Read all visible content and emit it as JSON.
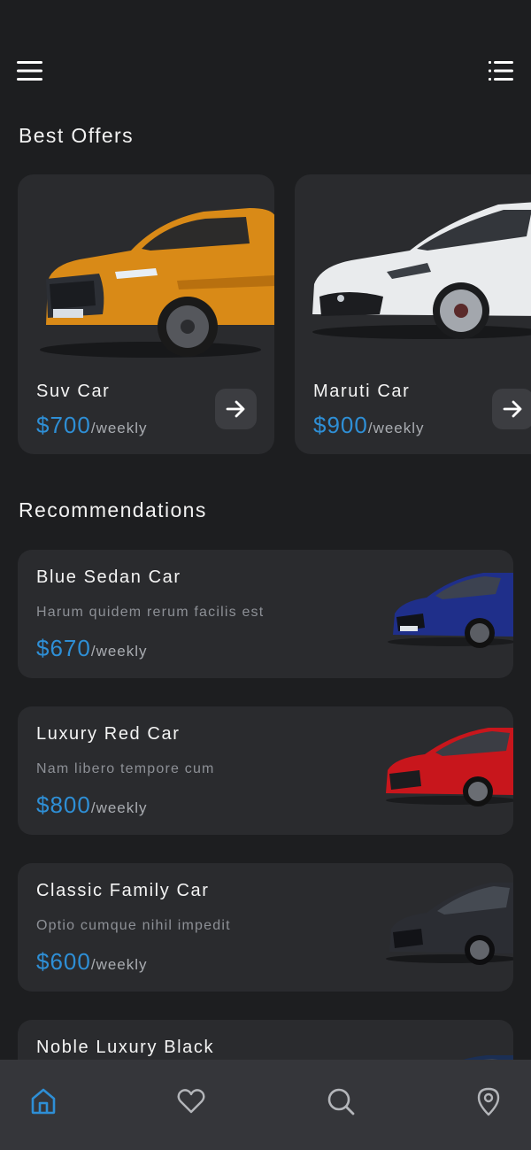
{
  "header": {
    "menu_icon": "hamburger-menu-icon",
    "list_icon": "list-icon"
  },
  "best_offers": {
    "title": "Best Offers",
    "items": [
      {
        "name": "Suv Car",
        "price": "$700",
        "unit": "/weekly",
        "car_color": "#d98a17"
      },
      {
        "name": "Maruti Car",
        "price": "$900",
        "unit": "/weekly",
        "car_color": "#eceef0"
      }
    ]
  },
  "recommendations": {
    "title": "Recommendations",
    "items": [
      {
        "name": "Blue Sedan Car",
        "desc": "Harum quidem rerum facilis est",
        "price": "$670",
        "unit": "/weekly",
        "car_color": "#1f2f8a"
      },
      {
        "name": "Luxury Red Car",
        "desc": "Nam libero tempore cum",
        "price": "$800",
        "unit": "/weekly",
        "car_color": "#c8161c"
      },
      {
        "name": "Classic Family Car",
        "desc": "Optio cumque nihil impedit",
        "price": "$600",
        "unit": "/weekly",
        "car_color": "#2b2d33"
      },
      {
        "name": "Noble Luxury Black",
        "desc": "",
        "price": "",
        "unit": "",
        "car_color": "#1b2f55"
      }
    ]
  },
  "bottom_nav": {
    "items": [
      "home-icon",
      "heart-icon",
      "search-icon",
      "location-pin-icon"
    ],
    "active_color": "#2e8fd6",
    "inactive_color": "#b4b6ba"
  },
  "colors": {
    "background": "#1d1e20",
    "card": "#2a2b2e",
    "accent": "#2e8fd6",
    "nav_bar": "#35363a"
  }
}
